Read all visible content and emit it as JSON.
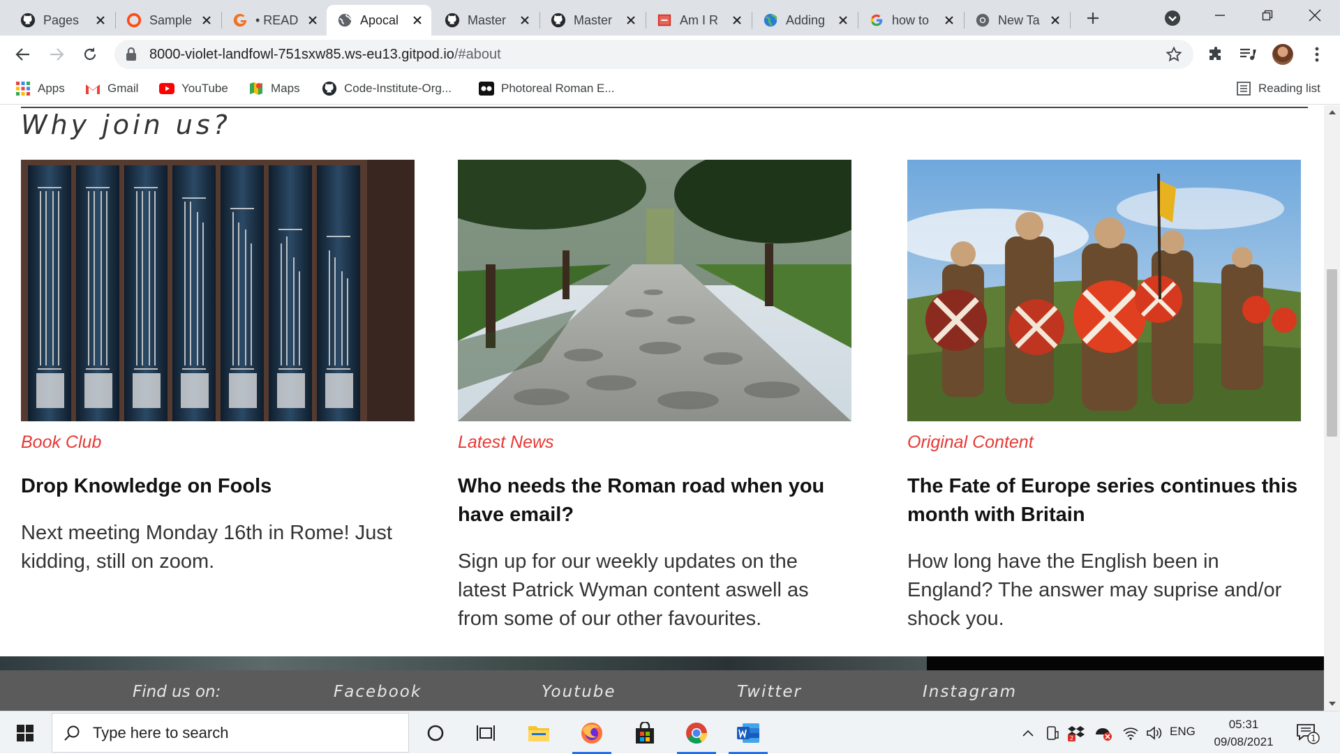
{
  "browser": {
    "tabs": [
      {
        "title": "Pages",
        "icon": "github-icon",
        "active": false
      },
      {
        "title": "Sample",
        "icon": "opera-circle-icon",
        "active": false
      },
      {
        "title": "• READ",
        "icon": "grammarly-icon",
        "active": false
      },
      {
        "title": "Apocal",
        "icon": "globe-icon",
        "active": true
      },
      {
        "title": "Master",
        "icon": "github-icon",
        "active": false
      },
      {
        "title": "Master",
        "icon": "github-icon",
        "active": false
      },
      {
        "title": "Am I R",
        "icon": "red-doc-icon",
        "active": false
      },
      {
        "title": "Adding",
        "icon": "earth-icon",
        "active": false
      },
      {
        "title": "how to",
        "icon": "google-icon",
        "active": false
      },
      {
        "title": "New Ta",
        "icon": "chrome-icon",
        "active": false
      }
    ],
    "url_host": "8000-violet-landfowl-751sxw85.ws-eu13.gitpod.io",
    "url_path": "/#about",
    "bookmarks": [
      {
        "label": "Apps",
        "icon": "apps-grid-icon"
      },
      {
        "label": "Gmail",
        "icon": "gmail-icon"
      },
      {
        "label": "YouTube",
        "icon": "youtube-icon"
      },
      {
        "label": "Maps",
        "icon": "maps-icon"
      },
      {
        "label": "Code-Institute-Org...",
        "icon": "github-icon"
      },
      {
        "label": "Photoreal Roman E...",
        "icon": "video-icon"
      }
    ],
    "reading_list": "Reading list"
  },
  "page": {
    "section_title": "Why join us?",
    "cards": [
      {
        "category": "Book Club",
        "title": "Drop Knowledge on Fools",
        "text": "Next meeting Monday 16th in Rome! Just kidding, still on zoom.",
        "image": "books-photo"
      },
      {
        "category": "Latest News",
        "title": "Who needs the Roman road when you have email?",
        "text": "Sign up for our weekly updates on the latest Patrick Wyman content aswell as from some of our other favourites.",
        "image": "roman-road-photo"
      },
      {
        "category": "Original Content",
        "title": "The Fate of Europe series continues this month with Britain",
        "text": "How long have the English been in England? The answer may suprise and/or shock you.",
        "image": "vikings-photo"
      }
    ],
    "footer": {
      "find_us": "Find us on:",
      "links": [
        "Facebook",
        "Youtube",
        "Twitter",
        "Instagram"
      ]
    }
  },
  "taskbar": {
    "search_placeholder": "Type here to search",
    "language": "ENG",
    "time": "05:31",
    "date": "09/08/2021",
    "notification_count": "1",
    "dropbox_badge": "2"
  },
  "colors": {
    "category_red": "#e53935",
    "footer_gray": "#5b5b5b",
    "tab_strip": "#dee1e6"
  }
}
